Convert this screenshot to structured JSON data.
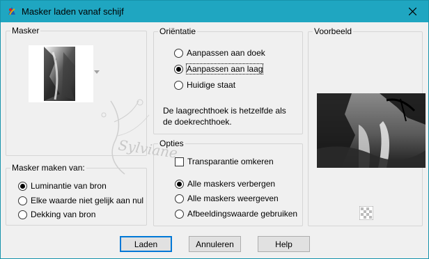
{
  "window": {
    "title": "Masker laden vanaf schijf"
  },
  "mask_group": {
    "title": "Masker"
  },
  "source_group": {
    "title": "Masker maken van:",
    "options": [
      {
        "label": "Luminantie van bron",
        "checked": true
      },
      {
        "label": "Elke waarde niet gelijk aan nul",
        "checked": false
      },
      {
        "label": "Dekking van bron",
        "checked": false
      }
    ]
  },
  "orientation_group": {
    "title": "Oriëntatie",
    "options": [
      {
        "label": "Aanpassen aan doek",
        "checked": false
      },
      {
        "label": "Aanpassen aan laag",
        "checked": true
      },
      {
        "label": "Huidige staat",
        "checked": false
      }
    ],
    "info_line1": "De laagrechthoek is hetzelfde als",
    "info_line2": "de doekrechthoek."
  },
  "options_group": {
    "title": "Opties",
    "invert_label": "Transparantie omkeren",
    "invert_checked": false,
    "options": [
      {
        "label": "Alle maskers verbergen",
        "checked": true
      },
      {
        "label": "Alle maskers weergeven",
        "checked": false
      },
      {
        "label": "Afbeeldingswaarde gebruiken",
        "checked": false
      }
    ]
  },
  "preview_group": {
    "title": "Voorbeeld"
  },
  "buttons": {
    "load": "Laden",
    "cancel": "Annuleren",
    "help": "Help"
  },
  "watermark_text": "Sylviane",
  "colors": {
    "accent": "#0078d7",
    "titlebar": "#1fa6c1",
    "background": "#f0f0f0"
  },
  "icons": [
    "app-icon",
    "close-icon",
    "chevron-down-icon",
    "transparency-checker-icon"
  ]
}
